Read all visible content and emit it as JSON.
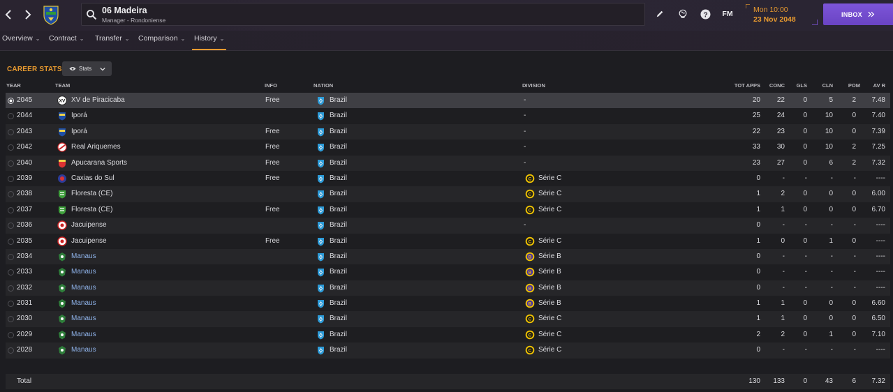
{
  "header": {
    "profile_name": "06 Madeira",
    "profile_sub": "Manager - Rondoniense",
    "fm_label": "FM",
    "date_line1": "Mon 10:00",
    "date_line2": "23 Nov 2048",
    "inbox_label": "INBOX"
  },
  "subnav": {
    "tabs": [
      {
        "label": "Overview"
      },
      {
        "label": "Contract"
      },
      {
        "label": "Transfer"
      },
      {
        "label": "Comparison"
      },
      {
        "label": "History"
      }
    ],
    "active_tab": "History"
  },
  "section": {
    "title": "CAREER STATS",
    "stats_button": "Stats"
  },
  "columns": {
    "year": "YEAR",
    "team": "TEAM",
    "info": "INFO",
    "nation": "NATION",
    "division": "DIVISION",
    "apps": "TOT APPS",
    "conc": "CONC",
    "gls": "GLS",
    "cln": "CLN",
    "pom": "POM",
    "avr": "AV R"
  },
  "rows": [
    {
      "year": "2045",
      "team": "XV de Piracicaba",
      "info": "Free",
      "nation": "Brazil",
      "division": "-",
      "apps": "20",
      "conc": "22",
      "gls": "0",
      "cln": "5",
      "pom": "2",
      "avr": "7.48",
      "link": false
    },
    {
      "year": "2044",
      "team": "Iporá",
      "info": "",
      "nation": "Brazil",
      "division": "-",
      "apps": "25",
      "conc": "24",
      "gls": "0",
      "cln": "10",
      "pom": "0",
      "avr": "7.40",
      "link": false
    },
    {
      "year": "2043",
      "team": "Iporá",
      "info": "Free",
      "nation": "Brazil",
      "division": "-",
      "apps": "22",
      "conc": "23",
      "gls": "0",
      "cln": "10",
      "pom": "0",
      "avr": "7.39",
      "link": false
    },
    {
      "year": "2042",
      "team": "Real Ariquemes",
      "info": "Free",
      "nation": "Brazil",
      "division": "-",
      "apps": "33",
      "conc": "30",
      "gls": "0",
      "cln": "10",
      "pom": "2",
      "avr": "7.25",
      "link": false
    },
    {
      "year": "2040",
      "team": "Apucarana Sports",
      "info": "Free",
      "nation": "Brazil",
      "division": "-",
      "apps": "23",
      "conc": "27",
      "gls": "0",
      "cln": "6",
      "pom": "2",
      "avr": "7.32",
      "link": false
    },
    {
      "year": "2039",
      "team": "Caxias do Sul",
      "info": "Free",
      "nation": "Brazil",
      "division": "Série C",
      "apps": "0",
      "conc": "-",
      "gls": "-",
      "cln": "-",
      "pom": "-",
      "avr": "----",
      "link": false
    },
    {
      "year": "2038",
      "team": "Floresta (CE)",
      "info": "",
      "nation": "Brazil",
      "division": "Série C",
      "apps": "1",
      "conc": "2",
      "gls": "0",
      "cln": "0",
      "pom": "0",
      "avr": "6.00",
      "link": false
    },
    {
      "year": "2037",
      "team": "Floresta (CE)",
      "info": "Free",
      "nation": "Brazil",
      "division": "Série C",
      "apps": "1",
      "conc": "1",
      "gls": "0",
      "cln": "0",
      "pom": "0",
      "avr": "6.70",
      "link": false
    },
    {
      "year": "2036",
      "team": "Jacuipense",
      "info": "",
      "nation": "Brazil",
      "division": "-",
      "apps": "0",
      "conc": "-",
      "gls": "-",
      "cln": "-",
      "pom": "-",
      "avr": "----",
      "link": false
    },
    {
      "year": "2035",
      "team": "Jacuipense",
      "info": "Free",
      "nation": "Brazil",
      "division": "Série C",
      "apps": "1",
      "conc": "0",
      "gls": "0",
      "cln": "1",
      "pom": "0",
      "avr": "----",
      "link": false
    },
    {
      "year": "2034",
      "team": "Manaus",
      "info": "",
      "nation": "Brazil",
      "division": "Série B",
      "apps": "0",
      "conc": "-",
      "gls": "-",
      "cln": "-",
      "pom": "-",
      "avr": "----",
      "link": true
    },
    {
      "year": "2033",
      "team": "Manaus",
      "info": "",
      "nation": "Brazil",
      "division": "Série B",
      "apps": "0",
      "conc": "-",
      "gls": "-",
      "cln": "-",
      "pom": "-",
      "avr": "----",
      "link": true
    },
    {
      "year": "2032",
      "team": "Manaus",
      "info": "",
      "nation": "Brazil",
      "division": "Série B",
      "apps": "0",
      "conc": "-",
      "gls": "-",
      "cln": "-",
      "pom": "-",
      "avr": "----",
      "link": true
    },
    {
      "year": "2031",
      "team": "Manaus",
      "info": "",
      "nation": "Brazil",
      "division": "Série B",
      "apps": "1",
      "conc": "1",
      "gls": "0",
      "cln": "0",
      "pom": "0",
      "avr": "6.60",
      "link": true
    },
    {
      "year": "2030",
      "team": "Manaus",
      "info": "",
      "nation": "Brazil",
      "division": "Série C",
      "apps": "1",
      "conc": "1",
      "gls": "0",
      "cln": "0",
      "pom": "0",
      "avr": "6.50",
      "link": true
    },
    {
      "year": "2029",
      "team": "Manaus",
      "info": "",
      "nation": "Brazil",
      "division": "Série C",
      "apps": "2",
      "conc": "2",
      "gls": "0",
      "cln": "1",
      "pom": "0",
      "avr": "7.10",
      "link": true
    },
    {
      "year": "2028",
      "team": "Manaus",
      "info": "",
      "nation": "Brazil",
      "division": "Série C",
      "apps": "0",
      "conc": "-",
      "gls": "-",
      "cln": "-",
      "pom": "-",
      "avr": "----",
      "link": true
    }
  ],
  "total": {
    "label": "Total",
    "apps": "130",
    "conc": "133",
    "gls": "0",
    "cln": "43",
    "pom": "6",
    "avr": "7.32"
  },
  "colors": {
    "accent": "#e89a2f",
    "inbox": "#7d55d8",
    "link": "#8fb3ea"
  }
}
